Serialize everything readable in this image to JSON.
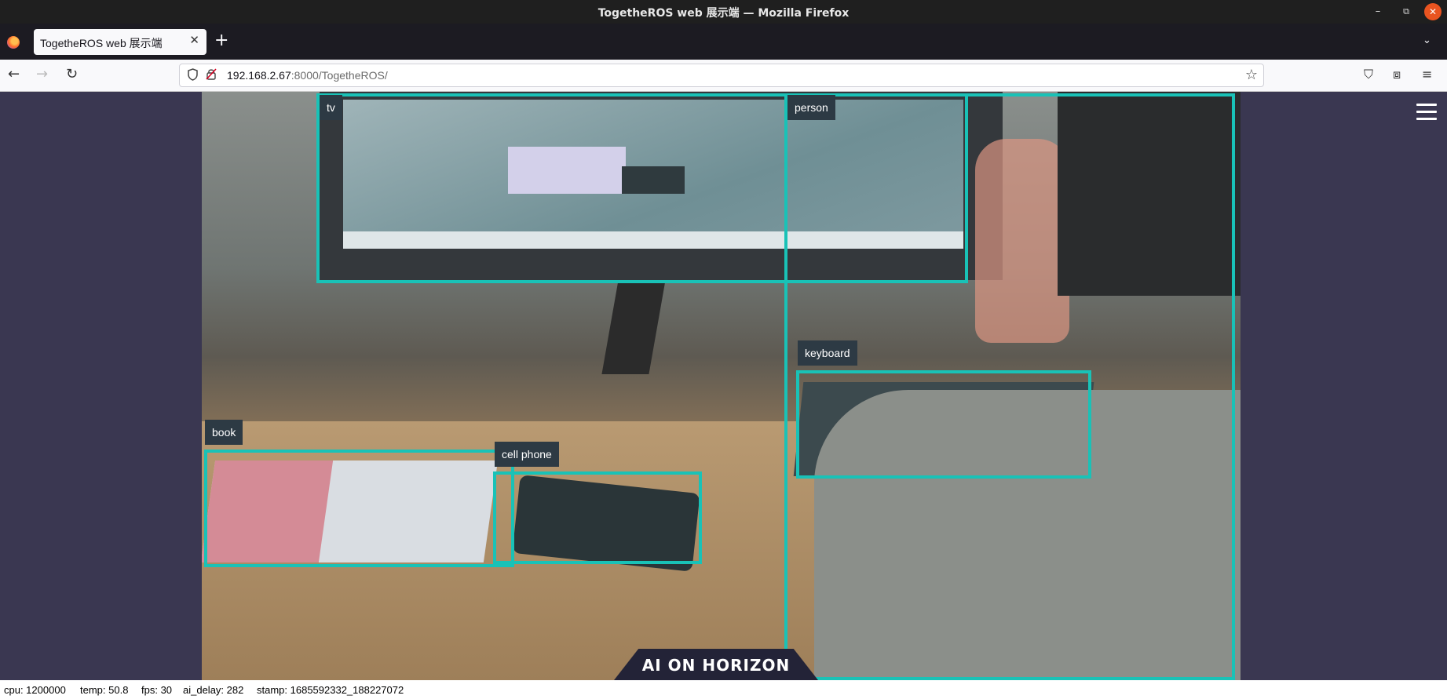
{
  "window": {
    "title": "TogetheROS web 展示端 — Mozilla Firefox",
    "minimize_glyph": "–",
    "maximize_glyph": "⧉",
    "close_glyph": "✕"
  },
  "tabs": [
    {
      "title": "TogetheROS web 展示端",
      "close_glyph": "✕"
    }
  ],
  "tabstrip": {
    "new_tab_glyph": "+",
    "list_all_tabs_glyph": "⌄"
  },
  "navigation": {
    "back_glyph": "←",
    "forward_glyph": "→",
    "reload_glyph": "↻",
    "url_host": "192.168.2.67",
    "url_rest": ":8000/TogetheROS/",
    "bookmark_glyph": "☆",
    "pocket_glyph": "⛉",
    "extensions_glyph": "⧈",
    "menu_glyph": "≡"
  },
  "detections": [
    {
      "label": "tv"
    },
    {
      "label": "person"
    },
    {
      "label": "keyboard"
    },
    {
      "label": "book"
    },
    {
      "label": "cell phone"
    }
  ],
  "detection_color": "#19c2b7",
  "brand": {
    "text": "AI ON HORIZON"
  },
  "status": {
    "cpu": "cpu: 1200000",
    "temp": "temp: 50.8",
    "fps": "fps: 30",
    "ai_delay": "ai_delay: 282",
    "stamp": "stamp: 1685592332_188227072"
  },
  "colors": {
    "page_background": "#3a3751",
    "titlebar": "#1f1f1f",
    "close_button": "#e95420"
  },
  "icons": [
    "firefox-logo-icon",
    "shield-icon",
    "lock-insecure-icon",
    "star-icon",
    "pocket-icon",
    "extensions-icon",
    "menu-icon",
    "hamburger-icon"
  ]
}
